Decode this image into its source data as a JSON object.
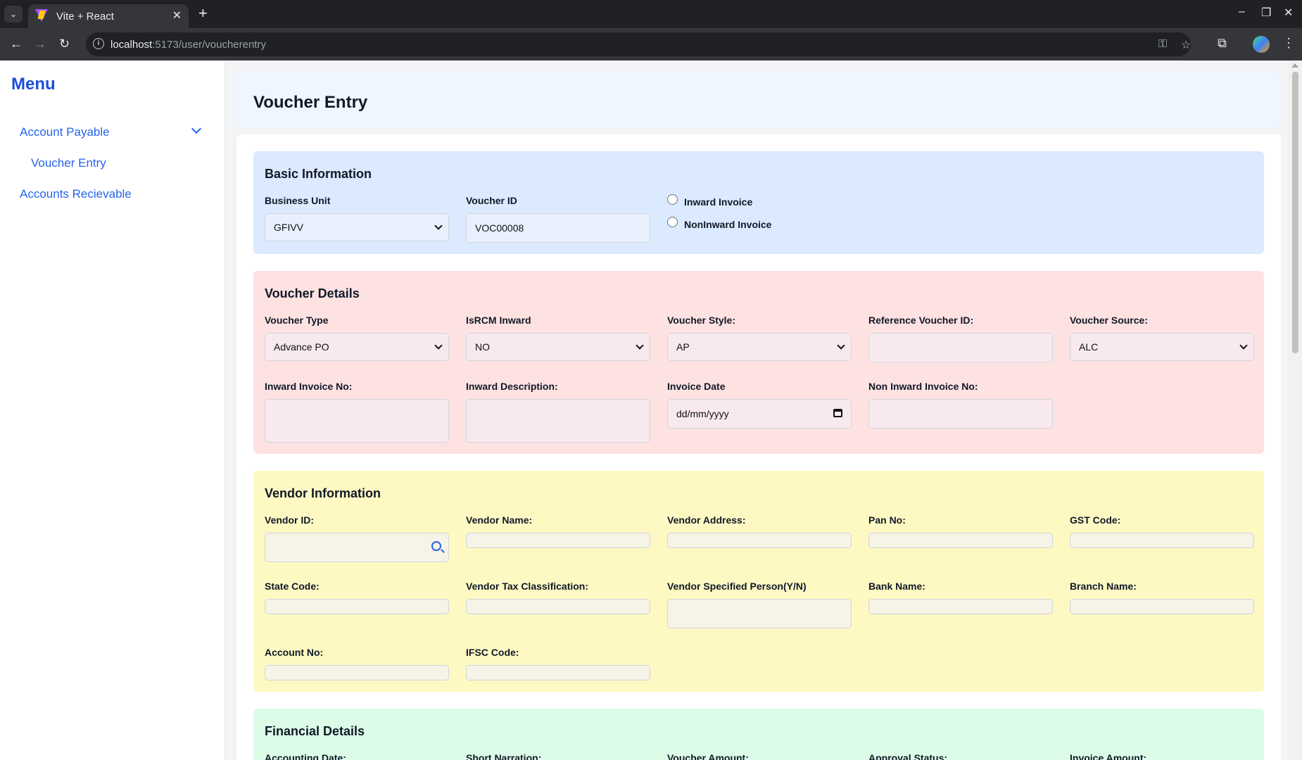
{
  "browser": {
    "tab_title": "Vite + React",
    "url_host": "localhost",
    "url_path": ":5173/user/voucherentry"
  },
  "sidebar": {
    "title": "Menu",
    "items": [
      {
        "label": "Account Payable"
      },
      {
        "label": "Voucher Entry"
      },
      {
        "label": "Accounts Recievable"
      }
    ]
  },
  "page": {
    "title": "Voucher Entry"
  },
  "basic": {
    "title": "Basic Information",
    "business_unit_label": "Business Unit",
    "business_unit_value": "GFIVV",
    "voucher_id_label": "Voucher ID",
    "voucher_id_value": "VOC00008",
    "radio_inward": "Inward Invoice",
    "radio_noninward": "NonInward Invoice"
  },
  "voucher": {
    "title": "Voucher Details",
    "type_label": "Voucher Type",
    "type_value": "Advance PO",
    "isrcm_label": "IsRCM Inward",
    "isrcm_value": "NO",
    "style_label": "Voucher Style:",
    "style_value": "AP",
    "ref_label": "Reference Voucher ID:",
    "source_label": "Voucher Source:",
    "source_value": "ALC",
    "inward_no_label": "Inward Invoice No:",
    "inward_desc_label": "Inward Description:",
    "invoice_date_label": "Invoice Date",
    "invoice_date_placeholder": "dd/mm/yyyy",
    "non_inward_label": "Non Inward Invoice No:"
  },
  "vendor": {
    "title": "Vendor Information",
    "id_label": "Vendor ID:",
    "name_label": "Vendor Name:",
    "address_label": "Vendor Address:",
    "pan_label": "Pan No:",
    "gst_label": "GST Code:",
    "state_label": "State Code:",
    "tax_label": "Vendor Tax Classification:",
    "specified_label": "Vendor Specified Person(Y/N)",
    "bank_label": "Bank Name:",
    "branch_label": "Branch Name:",
    "account_label": "Account No:",
    "ifsc_label": "IFSC Code:"
  },
  "financial": {
    "title": "Financial Details",
    "accounting_date_label": "Accounting Date:",
    "narration_label": "Short Narration:",
    "amount_label": "Voucher Amount:",
    "approval_label": "Approval Status:",
    "invoice_amount_label": "Invoice Amount:"
  }
}
